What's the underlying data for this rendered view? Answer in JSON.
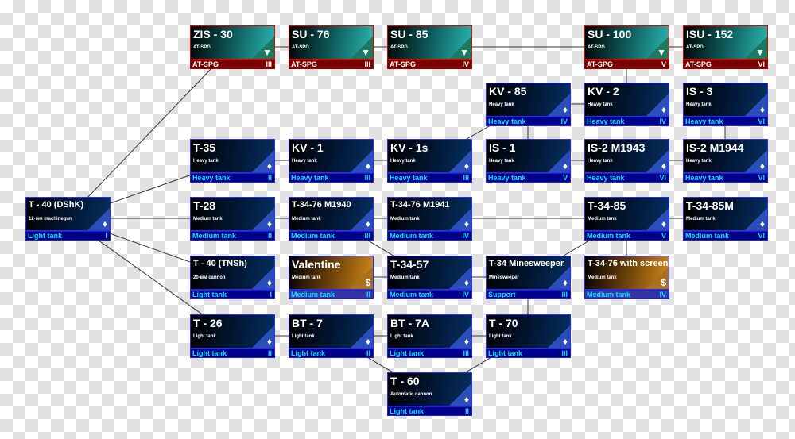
{
  "colors": {
    "edge": "#333333",
    "footer_text": "#00e6ff",
    "atspg_footer": "#7a0000",
    "tree_footer": "#00008a",
    "premium_footer": "#3434a8"
  },
  "nodes": [
    {
      "id": "t40dshk",
      "name": "T - 40 (DShK)",
      "sub": "12-мм machinegun",
      "cls": "Light tank",
      "tier": "I",
      "kind": "tree",
      "icon": "diamond-icon",
      "col": 0,
      "row": 3
    },
    {
      "id": "zis30",
      "name": "ZIS - 30",
      "sub": "AT-SPG",
      "cls": "AT-SPG",
      "tier": "III",
      "kind": "spg",
      "icon": "at-spg-icon",
      "col": 1,
      "row": 0
    },
    {
      "id": "su76",
      "name": "SU - 76",
      "sub": "AT-SPG",
      "cls": "AT-SPG",
      "tier": "III",
      "kind": "spg",
      "icon": "at-spg-icon",
      "col": 2,
      "row": 0
    },
    {
      "id": "su85",
      "name": "SU - 85",
      "sub": "AT-SPG",
      "cls": "AT-SPG",
      "tier": "IV",
      "kind": "spg",
      "icon": "at-spg-icon",
      "col": 3,
      "row": 0
    },
    {
      "id": "su100",
      "name": "SU - 100",
      "sub": "AT-SPG",
      "cls": "AT-SPG",
      "tier": "V",
      "kind": "spg",
      "icon": "at-spg-icon",
      "col": 5,
      "row": 0
    },
    {
      "id": "isu152",
      "name": "ISU - 152",
      "sub": "AT-SPG",
      "cls": "AT-SPG",
      "tier": "VI",
      "kind": "spg",
      "icon": "at-spg-icon",
      "col": 6,
      "row": 0
    },
    {
      "id": "kv85",
      "name": "KV - 85",
      "sub": "Heavy tank",
      "cls": "Heavy tank",
      "tier": "IV",
      "kind": "tree",
      "icon": "diamond-icon",
      "col": 4,
      "row": 1
    },
    {
      "id": "kv2",
      "name": "KV - 2",
      "sub": "Heavy tank",
      "cls": "Heavy tank",
      "tier": "IV",
      "kind": "tree",
      "icon": "diamond-icon",
      "col": 5,
      "row": 1
    },
    {
      "id": "is3",
      "name": "IS - 3",
      "sub": "Heavy tank",
      "cls": "Heavy tank",
      "tier": "VI",
      "kind": "tree",
      "icon": "diamond-icon",
      "col": 6,
      "row": 1
    },
    {
      "id": "t35",
      "name": "T-35",
      "sub": "Heavy tank",
      "cls": "Heavy tank",
      "tier": "II",
      "kind": "tree",
      "icon": "diamond-icon",
      "col": 1,
      "row": 2
    },
    {
      "id": "kv1",
      "name": "KV - 1",
      "sub": "Heavy tank",
      "cls": "Heavy tank",
      "tier": "III",
      "kind": "tree",
      "icon": "diamond-icon",
      "col": 2,
      "row": 2
    },
    {
      "id": "kv1s",
      "name": "KV - 1s",
      "sub": "Heavy tank",
      "cls": "Heavy tank",
      "tier": "III",
      "kind": "tree",
      "icon": "diamond-icon",
      "col": 3,
      "row": 2
    },
    {
      "id": "is1",
      "name": "IS - 1",
      "sub": "Heavy tank",
      "cls": "Heavy tank",
      "tier": "V",
      "kind": "tree",
      "icon": "diamond-icon",
      "col": 4,
      "row": 2
    },
    {
      "id": "is2m43",
      "name": "IS-2 M1943",
      "sub": "Heavy tank",
      "cls": "Heavy tank",
      "tier": "VI",
      "kind": "tree",
      "icon": "diamond-icon",
      "col": 5,
      "row": 2
    },
    {
      "id": "is2m44",
      "name": "IS-2 M1944",
      "sub": "Heavy tank",
      "cls": "Heavy tank",
      "tier": "VI",
      "kind": "tree",
      "icon": "diamond-icon",
      "col": 6,
      "row": 2
    },
    {
      "id": "t28",
      "name": "T-28",
      "sub": "Medium tank",
      "cls": "Medium tank",
      "tier": "II",
      "kind": "tree",
      "icon": "diamond-icon",
      "col": 1,
      "row": 3
    },
    {
      "id": "t3476m40",
      "name": "T-34-76 M1940",
      "sub": "Medium tank",
      "cls": "Medium tank",
      "tier": "III",
      "kind": "tree",
      "icon": "diamond-icon",
      "col": 2,
      "row": 3
    },
    {
      "id": "t3476m41",
      "name": "T-34-76 M1941",
      "sub": "Medium tank",
      "cls": "Medium tank",
      "tier": "IV",
      "kind": "tree",
      "icon": "diamond-icon",
      "col": 3,
      "row": 3
    },
    {
      "id": "t3485",
      "name": "T-34-85",
      "sub": "Medium tank",
      "cls": "Medium tank",
      "tier": "V",
      "kind": "tree",
      "icon": "diamond-icon",
      "col": 5,
      "row": 3
    },
    {
      "id": "t3485m",
      "name": "T-34-85M",
      "sub": "Medium tank",
      "cls": "Medium tank",
      "tier": "VI",
      "kind": "tree",
      "icon": "diamond-icon",
      "col": 6,
      "row": 3
    },
    {
      "id": "t40tnsh",
      "name": "T - 40 (TNSh)",
      "sub": "20-мм cannon",
      "cls": "Light tank",
      "tier": "I",
      "kind": "tree",
      "icon": "diamond-icon",
      "col": 1,
      "row": 4
    },
    {
      "id": "valentine",
      "name": "Valentine",
      "sub": "Medium tank",
      "cls": "Medium tank",
      "tier": "II",
      "kind": "prem",
      "icon": "dollar-icon",
      "col": 2,
      "row": 4
    },
    {
      "id": "t3457",
      "name": "T-34-57",
      "sub": "Medium tank",
      "cls": "Medium tank",
      "tier": "IV",
      "kind": "tree",
      "icon": "diamond-icon",
      "col": 3,
      "row": 4
    },
    {
      "id": "t34mine",
      "name": "T-34 Minesweeper",
      "sub": "Minesweeper",
      "cls": "Support",
      "tier": "III",
      "kind": "tree",
      "icon": "diamond-icon",
      "col": 4,
      "row": 4
    },
    {
      "id": "t3476scr",
      "name": "T-34-76 with screens",
      "sub": "Medium tank",
      "cls": "Medium tank",
      "tier": "IV",
      "kind": "prem",
      "icon": "dollar-icon",
      "col": 5,
      "row": 4
    },
    {
      "id": "t26",
      "name": "T - 26",
      "sub": "Light tank",
      "cls": "Light tank",
      "tier": "II",
      "kind": "tree",
      "icon": "diamond-icon",
      "col": 1,
      "row": 5
    },
    {
      "id": "bt7",
      "name": "BT - 7",
      "sub": "Light tank",
      "cls": "Light tank",
      "tier": "II",
      "kind": "tree",
      "icon": "diamond-icon",
      "col": 2,
      "row": 5
    },
    {
      "id": "bt7a",
      "name": "BT - 7A",
      "sub": "Light tank",
      "cls": "Light tank",
      "tier": "III",
      "kind": "tree",
      "icon": "diamond-icon",
      "col": 3,
      "row": 5
    },
    {
      "id": "t70",
      "name": "T - 70",
      "sub": "Light tank",
      "cls": "Light tank",
      "tier": "III",
      "kind": "tree",
      "icon": "diamond-icon",
      "col": 4,
      "row": 5
    },
    {
      "id": "t60",
      "name": "T - 60",
      "sub": "Automatic cannon",
      "cls": "Light tank",
      "tier": "II",
      "kind": "tree",
      "icon": "diamond-icon",
      "col": 3,
      "row": 6
    }
  ],
  "edges": [
    [
      "t40dshk",
      "zis30"
    ],
    [
      "t40dshk",
      "t35"
    ],
    [
      "t40dshk",
      "t28"
    ],
    [
      "t40dshk",
      "t40tnsh"
    ],
    [
      "t40dshk",
      "t26"
    ],
    [
      "zis30",
      "su76"
    ],
    [
      "su76",
      "su85"
    ],
    [
      "su85",
      "su100"
    ],
    [
      "su100",
      "isu152"
    ],
    [
      "t35",
      "kv1"
    ],
    [
      "kv1",
      "kv1s"
    ],
    [
      "kv1s",
      "kv85"
    ],
    [
      "kv85",
      "kv2"
    ],
    [
      "kv85",
      "is1"
    ],
    [
      "kv2",
      "su100"
    ],
    [
      "is1",
      "is2m43"
    ],
    [
      "is2m43",
      "is2m44"
    ],
    [
      "is2m44",
      "is3"
    ],
    [
      "t28",
      "t3476m40"
    ],
    [
      "t3476m40",
      "t3476m41"
    ],
    [
      "t3476m41",
      "t3485"
    ],
    [
      "t3485",
      "t3485m"
    ],
    [
      "t3476m40",
      "t3457"
    ],
    [
      "valentine",
      "t3457"
    ],
    [
      "t3457",
      "t34mine"
    ],
    [
      "t34mine",
      "t3485"
    ],
    [
      "t3485",
      "t3476scr"
    ],
    [
      "t26",
      "bt7"
    ],
    [
      "bt7",
      "bt7a"
    ],
    [
      "bt7a",
      "t70"
    ],
    [
      "bt7",
      "t60"
    ],
    [
      "t70",
      "t60"
    ],
    [
      "t70",
      "t34mine"
    ]
  ]
}
